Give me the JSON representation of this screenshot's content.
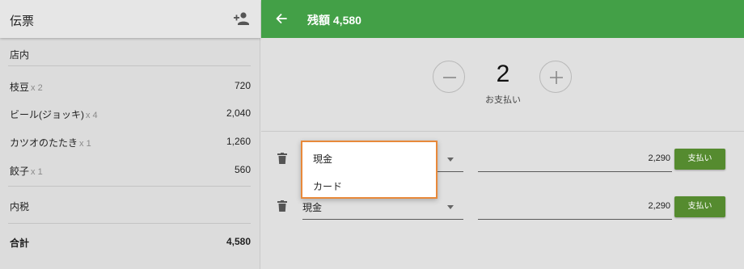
{
  "left_panel": {
    "title": "伝票",
    "add_person_icon": "person-add-icon",
    "section_label": "店内",
    "items": [
      {
        "name": "枝豆",
        "qty": "x 2",
        "price": "720"
      },
      {
        "name": "ビール(ジョッキ)",
        "qty": "x 4",
        "price": "2,040"
      },
      {
        "name": "カツオのたたき",
        "qty": "x 1",
        "price": "1,260"
      },
      {
        "name": "餃子",
        "qty": "x 1",
        "price": "560"
      }
    ],
    "tax_label": "内税",
    "total_label": "合計",
    "total_value": "4,580"
  },
  "header": {
    "back_icon": "arrow-back-icon",
    "title": "残額 4,580",
    "color": "#43a047"
  },
  "stepper": {
    "minus_icon": "minus-icon",
    "plus_icon": "plus-icon",
    "count": "2",
    "label": "お支払い"
  },
  "payments": [
    {
      "method": "現金",
      "amount": "2,290",
      "button_label": "支払い"
    },
    {
      "method": "現金",
      "amount": "2,290",
      "button_label": "支払い"
    }
  ],
  "dropdown": {
    "options": [
      "現金",
      "カード"
    ],
    "highlight_color": "#e8893a"
  },
  "accent": {
    "pay_button_color": "#558b2f"
  }
}
